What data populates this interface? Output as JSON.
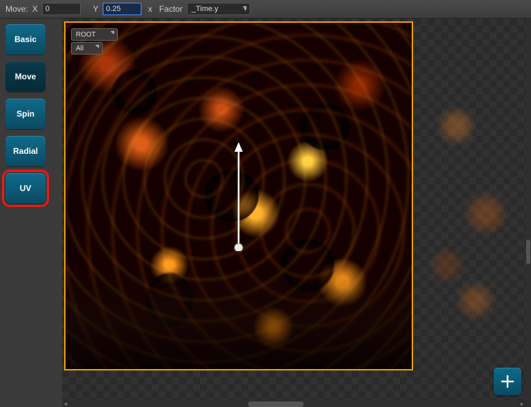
{
  "toolbar": {
    "move_label": "Move:",
    "x_label": "X",
    "x_value": "0",
    "y_label": "Y",
    "y_value": "0.25",
    "times_label": "x",
    "factor_label": "Factor",
    "factor_value": "_Time.y"
  },
  "sidebar": {
    "tabs": [
      {
        "label": "Basic"
      },
      {
        "label": "Move"
      },
      {
        "label": "Spin"
      },
      {
        "label": "Radial"
      },
      {
        "label": "UV"
      }
    ],
    "selected_index": 4
  },
  "viewport": {
    "root_dropdown": "ROOT",
    "filter_dropdown": "All",
    "border_color": "#f2a100",
    "arrow_direction": "up"
  },
  "add_button": {
    "label": "+"
  },
  "colors": {
    "accent": "#0f6a8a",
    "selection_outline": "#f01818"
  }
}
